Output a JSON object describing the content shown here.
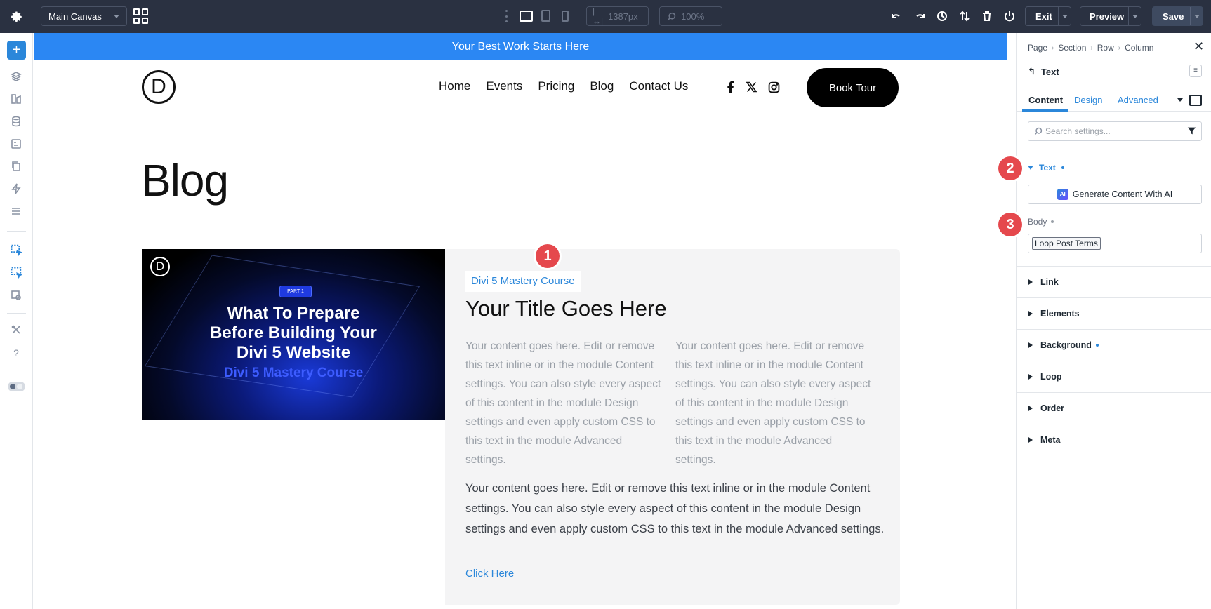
{
  "toolbar": {
    "canvas_select": "Main Canvas",
    "width_value": "1387px",
    "zoom_value": "100%",
    "exit_label": "Exit",
    "preview_label": "Preview",
    "save_label": "Save"
  },
  "page": {
    "banner_text": "Your Best Work Starts Here",
    "logo_letter": "D",
    "nav": [
      "Home",
      "Events",
      "Pricing",
      "Blog",
      "Contact Us"
    ],
    "cta_label": "Book Tour",
    "heading": "Blog"
  },
  "card": {
    "image": {
      "logo_letter": "D",
      "part_label": "PART 1",
      "title_lines": [
        "What To Prepare",
        "Before Building Your",
        "Divi 5 Website"
      ],
      "subtitle": "Divi 5 Mastery Course"
    },
    "tag": "Divi 5 Mastery Course",
    "title": "Your Title Goes Here",
    "column_text": "Your content goes here. Edit or remove this text inline or in the module Content settings. You can also style every aspect of this content in the module Design settings and even apply custom CSS to this text in the module Advanced settings.",
    "paragraph": "Your content goes here. Edit or remove this text inline or in the module Content settings. You can also style every aspect of this content in the module Design settings and even apply custom CSS to this text in the module Advanced settings.",
    "link_label": "Click Here"
  },
  "badges": [
    "1",
    "2",
    "3"
  ],
  "panel": {
    "breadcrumb": [
      "Page",
      "Section",
      "Row",
      "Column"
    ],
    "module_name": "Text",
    "tabs": [
      "Content",
      "Design",
      "Advanced"
    ],
    "search_placeholder": "Search settings...",
    "text_section": "Text",
    "ai_button": "Generate Content With AI",
    "ai_badge": "AI",
    "body_label": "Body",
    "body_value": "Loop Post Terms",
    "accordions": [
      "Link",
      "Elements",
      "Background",
      "Loop",
      "Order",
      "Meta"
    ]
  },
  "colors": {
    "accent": "#2b87da",
    "banner": "#2b87f3",
    "badge": "#e5484d",
    "toolbar": "#2a3141"
  },
  "icons": {
    "left_sidebar": [
      "add-icon",
      "layers-icon",
      "theme-builder-icon",
      "database-icon",
      "portability-icon",
      "pages-icon",
      "lightning-icon",
      "wireframe-icon",
      "loop-builder-icon",
      "loop-builder-active-icon",
      "preset-icon",
      "tools-icon",
      "help-icon"
    ]
  }
}
